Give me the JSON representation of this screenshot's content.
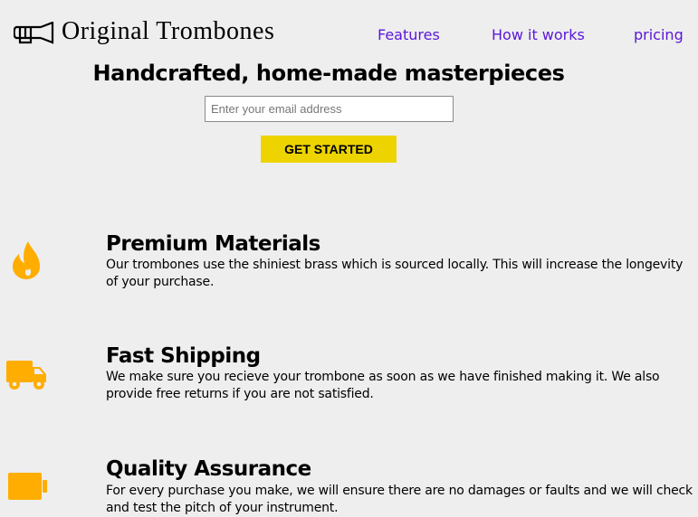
{
  "header": {
    "brand": "Original Trombones",
    "logo_icon": "trombone-logo-icon",
    "nav": [
      {
        "label": "Features"
      },
      {
        "label": "How it works"
      },
      {
        "label": "pricing"
      }
    ],
    "nav_color": "#5a16d9"
  },
  "hero": {
    "title": "Handcrafted, home-made masterpieces",
    "email_placeholder": "Enter your email address",
    "button_label": "GET STARTED",
    "button_color": "#edd400"
  },
  "features": [
    {
      "icon": "fire-icon",
      "title": "Premium Materials",
      "description": "Our trombones use the shiniest brass which is sourced locally. This will increase the longevity of your purchase."
    },
    {
      "icon": "truck-icon",
      "title": "Fast Shipping",
      "description": "We make sure you recieve your trombone as soon as we have finished making it. We also provide free returns if you are not satisfied."
    },
    {
      "icon": "battery-icon",
      "title": "Quality Assurance",
      "description": "For every purchase you make, we will ensure there are no damages or faults and we will check and test the pitch of your instrument."
    }
  ],
  "icon_color": "#ffad00"
}
